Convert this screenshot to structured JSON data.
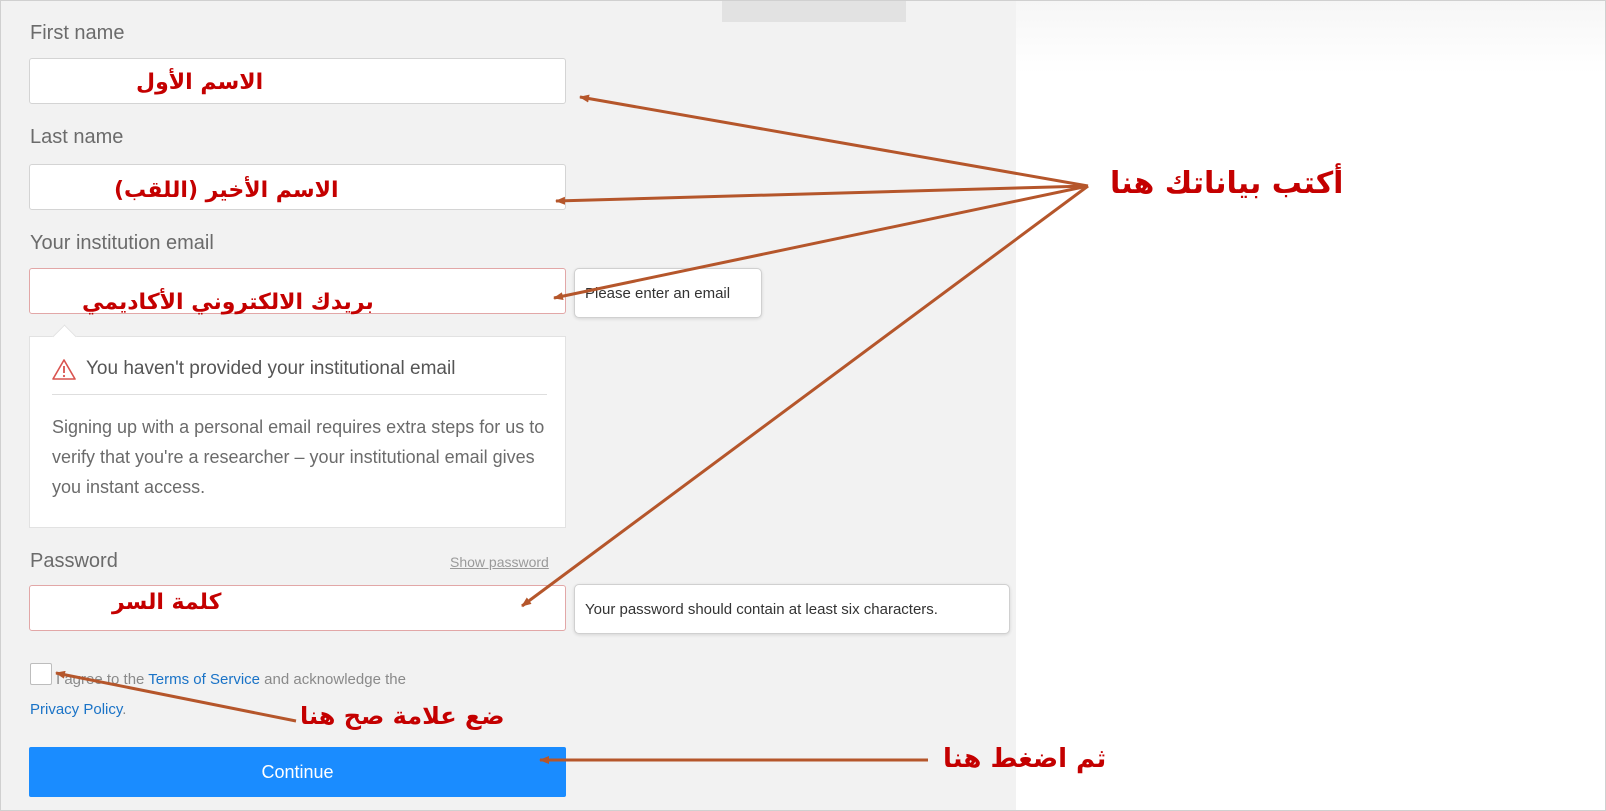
{
  "form": {
    "first_name_label": "First name",
    "last_name_label": "Last name",
    "email_label": "Your institution email",
    "password_label": "Password",
    "show_password": "Show password",
    "email_error": "Please enter an email",
    "password_error": "Your password should contain at least six characters.",
    "warning_title": "You haven't provided your institutional email",
    "warning_body": "Signing up with a personal email requires extra steps for us to verify that you're a researcher – your institutional email gives you instant access.",
    "terms_prefix": "I agree to the ",
    "terms_link": "Terms of Service",
    "terms_middle": " and acknowledge the ",
    "privacy_link": "Privacy Policy",
    "terms_suffix": ".",
    "continue_label": "Continue"
  },
  "annotations": {
    "first_name": "الاسم الأول",
    "last_name": "الاسم الأخير (اللقب)",
    "email": "بريدك الالكتروني الأكاديمي",
    "password": "كلمة السر",
    "write_here": "أكتب بياناتك هنا",
    "check_here": "ضع علامة صح هنا",
    "then_click": "ثم اضغط هنا"
  },
  "colors": {
    "annotation_text": "#c40000",
    "arrow": "#b5562b",
    "button": "#1a8cff",
    "link": "#1a73c7"
  },
  "icons": {
    "warning": "warning-triangle-icon"
  }
}
